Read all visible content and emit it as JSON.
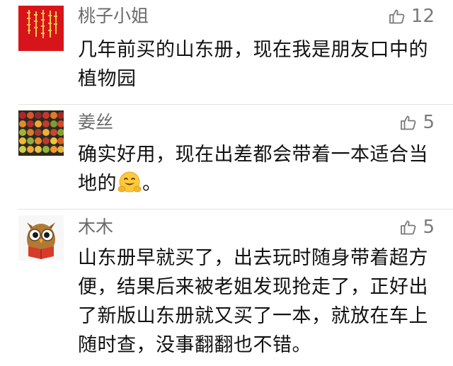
{
  "comments": [
    {
      "author": "桃子小姐",
      "likes": "12",
      "text": "几年前买的山东册，现在我是朋友口中的植物园",
      "avatar_icon": "red-calligraphy-avatar",
      "avatar_color": "#d8141b"
    },
    {
      "author": "姜丝",
      "likes": "5",
      "text_before_emoji": "确实好用，现在出差都会带着一本适合当地的",
      "emoji_icon": "hugging-face-emoji",
      "text_after_emoji": "。",
      "avatar_icon": "fruit-grid-avatar"
    },
    {
      "author": "木木",
      "likes": "5",
      "text": "山东册早就买了，出去玩时随身带着超方便，结果后来被老姐发现抢走了，正好出了新版山东册就又买了一本，就放在车上随时查，没事翻翻也不错。",
      "avatar_icon": "owl-reading-book-avatar"
    }
  ],
  "like_icon": "thumbs-up-icon",
  "colors": {
    "author": "#6b6b6b",
    "text": "#111111",
    "like": "#7a7a7a",
    "divider": "#e2e2e2"
  }
}
